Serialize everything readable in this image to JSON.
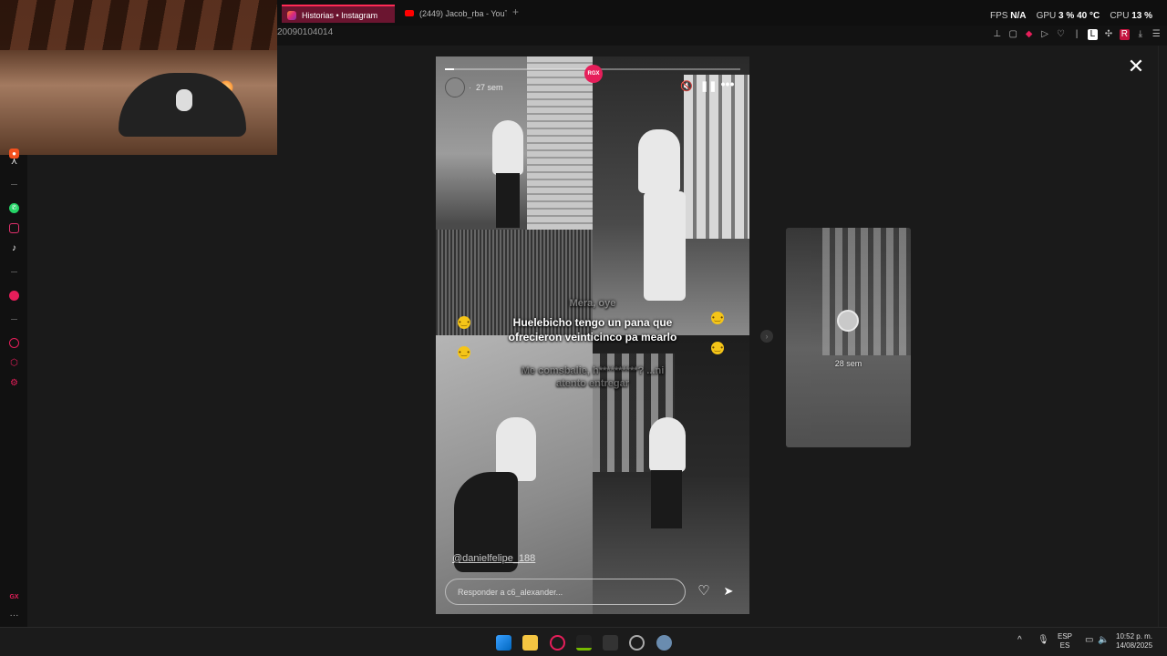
{
  "browser": {
    "tabs": [
      {
        "label": "Historias • Instagram"
      },
      {
        "label": "(2449) Jacob_rba - YouT"
      }
    ],
    "new_tab": "+",
    "url": "20090104014",
    "stats": {
      "fps_label": "FPS",
      "fps_value": "N/A",
      "gpu_label": "GPU",
      "gpu_value": "3 %",
      "gpu_temp": "40 °C",
      "cpu_label": "CPU",
      "cpu_value": "13 %"
    }
  },
  "sidebar": {
    "bottom_label": "GX",
    "more": "···"
  },
  "story": {
    "time": "27 sem",
    "badge": "RGX",
    "progress_fraction": 0.03,
    "caption_top": "Mera, oye",
    "caption_main": "Huelebicho tengo un pana que ofrecieron veinticinco pa mearlo",
    "caption_sub": "Me comsbalie, h**********? ...ni atento entregar",
    "mention": "@danielfelipe_188",
    "reply_placeholder": "Responder a c6_alexander...",
    "mute_icon": "🔇",
    "pause_icon": "❚❚",
    "more_icon": "•••",
    "like_icon": "♡",
    "send_icon": "➤"
  },
  "next_story": {
    "time": "28 sem"
  },
  "close_icon": "✕",
  "next_arrow": "›",
  "taskbar": {
    "lang_line1": "ESP",
    "lang_line2": "ES",
    "time": "10:52 p. m.",
    "date": "14/08/2025"
  },
  "colors": {
    "accent": "#e61e5a",
    "tab_active": "#6b1530",
    "background": "#1a1a1a"
  }
}
